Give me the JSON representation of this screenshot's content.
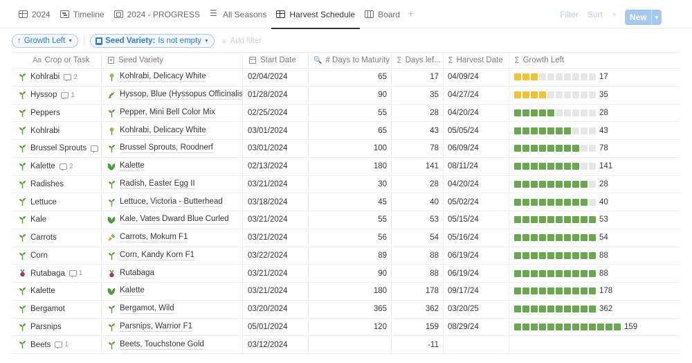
{
  "tabs": [
    {
      "label": "2024",
      "icon": "table-icon",
      "active": false
    },
    {
      "label": "Timeline",
      "icon": "timeline-icon",
      "active": false
    },
    {
      "label": "2024 - PROGRESS",
      "icon": "gallery-icon",
      "active": false
    },
    {
      "label": "All Seasons",
      "icon": "list-icon",
      "active": false
    },
    {
      "label": "Harvest Schedule",
      "icon": "table-icon",
      "active": true
    },
    {
      "label": "Board",
      "icon": "board-icon",
      "active": false
    }
  ],
  "toolbar": {
    "filter_label": "Filter",
    "sort_label": "Sort",
    "new_label": "New",
    "icons": [
      "lightning-icon",
      "search-icon",
      "expand-icon",
      "more-icon"
    ]
  },
  "filters": {
    "sort_pill": {
      "label": "Growth Left",
      "arrow": "↑"
    },
    "filter_pill": {
      "field": "Seed Variety:",
      "condition": "Is not empty"
    },
    "add_filter": "Add filter"
  },
  "columns": [
    {
      "label": "Crop or Task",
      "icon": "text-icon"
    },
    {
      "label": "Seed Variety",
      "icon": "relation-icon"
    },
    {
      "label": "Start Date",
      "icon": "calendar-icon"
    },
    {
      "label": "# Days to Maturity",
      "icon": "number-icon"
    },
    {
      "label": "Days lef...",
      "icon": "sigma-icon"
    },
    {
      "label": "Harvest Date",
      "icon": "sigma-icon"
    },
    {
      "label": "Growth Left",
      "icon": "sigma-icon"
    }
  ],
  "colors": {
    "progress_green": "#6aa84f",
    "progress_yellow": "#f1c232",
    "progress_empty": "#e6e6e4",
    "accent_blue": "#2f7bd3"
  },
  "rows": [
    {
      "crop": "Kohlrabi",
      "comments": "2",
      "seed": "Kohlrabi, Delicacy White",
      "seed_icon": "sprout-icon",
      "start": "02/04/2024",
      "maturity": "65",
      "days_left": "17",
      "harvest": "04/09/24",
      "growth_left": "17",
      "filled": 3,
      "color": "y"
    },
    {
      "crop": "Hyssop",
      "comments": "1",
      "seed": "Hyssop, Blue (Hyssopus Officinalis)",
      "seed_icon": "herb-icon",
      "start": "01/28/2024",
      "maturity": "90",
      "days_left": "35",
      "harvest": "04/27/24",
      "growth_left": "35",
      "filled": 4,
      "color": "y"
    },
    {
      "crop": "Peppers",
      "comments": "",
      "seed": "Pepper, Mini Bell Color Mix",
      "seed_icon": "seedling-icon",
      "start": "02/25/2024",
      "maturity": "55",
      "days_left": "28",
      "harvest": "04/20/24",
      "growth_left": "28",
      "filled": 5,
      "color": "g"
    },
    {
      "crop": "Kohlrabi",
      "comments": "",
      "seed": "Kohlrabi, Delicacy White",
      "seed_icon": "sprout-icon",
      "start": "03/01/2024",
      "maturity": "65",
      "days_left": "43",
      "harvest": "05/05/24",
      "growth_left": "43",
      "filled": 7,
      "color": "g"
    },
    {
      "crop": "Brussel Sprouts",
      "comments": "",
      "seed": "Brussel Sprouts, Roodnerf",
      "seed_icon": "seedling-icon",
      "start": "03/01/2024",
      "maturity": "100",
      "days_left": "78",
      "harvest": "06/09/24",
      "growth_left": "78",
      "filled": 8,
      "color": "g"
    },
    {
      "crop": "Kalette",
      "comments": "2",
      "seed": "Kalette",
      "seed_icon": "leaf-icon",
      "start": "02/13/2024",
      "maturity": "180",
      "days_left": "141",
      "harvest": "08/11/24",
      "growth_left": "141",
      "filled": 8,
      "color": "g"
    },
    {
      "crop": "Radishes",
      "comments": "",
      "seed": "Radish, Easter Egg II",
      "seed_icon": "seedling-icon",
      "start": "03/21/2024",
      "maturity": "30",
      "days_left": "28",
      "harvest": "04/20/24",
      "growth_left": "28",
      "filled": 9,
      "color": "g"
    },
    {
      "crop": "Lettuce",
      "comments": "",
      "seed": "Lettuce, Victoria - Butterhead",
      "seed_icon": "seedling-icon",
      "start": "03/18/2024",
      "maturity": "45",
      "days_left": "40",
      "harvest": "05/02/24",
      "growth_left": "40",
      "filled": 9,
      "color": "g"
    },
    {
      "crop": "Kale",
      "comments": "",
      "seed": "Kale, Vates Dward Blue Curled",
      "seed_icon": "leaf-icon",
      "start": "03/21/2024",
      "maturity": "55",
      "days_left": "53",
      "harvest": "05/15/24",
      "growth_left": "53",
      "filled": 10,
      "color": "g"
    },
    {
      "crop": "Carrots",
      "comments": "",
      "seed": "Carrots, Mokum F1",
      "seed_icon": "carrot-icon",
      "start": "03/21/2024",
      "maturity": "56",
      "days_left": "54",
      "harvest": "05/16/24",
      "growth_left": "54",
      "filled": 10,
      "color": "g"
    },
    {
      "crop": "Corn",
      "comments": "",
      "seed": "Corn, Kandy Korn F1",
      "seed_icon": "seedling-icon",
      "start": "03/22/2024",
      "maturity": "89",
      "days_left": "88",
      "harvest": "06/19/24",
      "growth_left": "88",
      "filled": 10,
      "color": "g"
    },
    {
      "crop": "Rutabaga",
      "comments": "1",
      "seed": "Rutabaga",
      "seed_icon": "beet-icon",
      "start": "03/21/2024",
      "maturity": "90",
      "days_left": "88",
      "harvest": "06/19/24",
      "growth_left": "88",
      "filled": 10,
      "color": "g"
    },
    {
      "crop": "Kalette",
      "comments": "",
      "seed": "Kalette",
      "seed_icon": "leaf-icon",
      "start": "03/21/2024",
      "maturity": "180",
      "days_left": "178",
      "harvest": "09/17/24",
      "growth_left": "178",
      "filled": 10,
      "color": "g"
    },
    {
      "crop": "Bergamot",
      "comments": "",
      "seed": "Bergamot, Wild",
      "seed_icon": "seedling-icon",
      "start": "03/20/2024",
      "maturity": "365",
      "days_left": "362",
      "harvest": "03/20/25",
      "growth_left": "362",
      "filled": 10,
      "color": "g"
    },
    {
      "crop": "Parsnips",
      "comments": "",
      "seed": "Parsnips, Warrior F1",
      "seed_icon": "seedling-icon",
      "start": "05/01/2024",
      "maturity": "120",
      "days_left": "159",
      "harvest": "08/29/24",
      "growth_left": "159",
      "filled": 13,
      "color": "g"
    },
    {
      "crop": "Beets",
      "comments": "1",
      "seed": "Beets, Touchstone Gold",
      "seed_icon": "seedling-icon",
      "start": "03/12/2024",
      "maturity": "",
      "days_left": "-11",
      "harvest": "",
      "growth_left": "",
      "filled": 0,
      "color": "none"
    }
  ]
}
